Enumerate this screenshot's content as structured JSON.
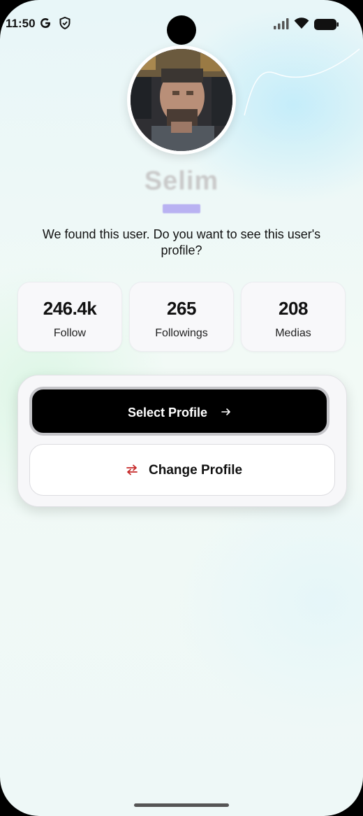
{
  "status_bar": {
    "time": "11:50",
    "left_icons": [
      "google-icon",
      "shield-icon"
    ],
    "right_icons": [
      "signal-icon",
      "wifi-icon",
      "battery-icon"
    ]
  },
  "profile": {
    "name": "Selim",
    "username": "selim"
  },
  "prompt_text": "We found this user. Do you want to see this user's profile?",
  "stats": [
    {
      "value": "246.4k",
      "label": "Follow"
    },
    {
      "value": "265",
      "label": "Followings"
    },
    {
      "value": "208",
      "label": "Medias"
    }
  ],
  "actions": {
    "select_label": "Select Profile",
    "change_label": "Change Profile"
  },
  "colors": {
    "primary_button": "#000000",
    "swap_icon": "#c62828",
    "username_badge": "#b9b2f2"
  }
}
